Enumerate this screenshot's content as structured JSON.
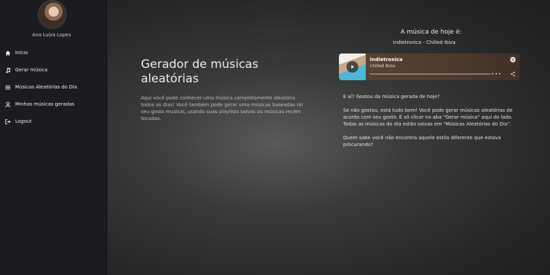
{
  "sidebar": {
    "user_name": "Ana Luiza Lopes",
    "items": [
      {
        "label": "Início",
        "icon": "home-icon"
      },
      {
        "label": "Gerar música",
        "icon": "music-note-icon"
      },
      {
        "label": "Músicas Aleatórias do Dia",
        "icon": "list-icon"
      },
      {
        "label": "Minhas músicas geradas",
        "icon": "user-icon"
      },
      {
        "label": "Logout",
        "icon": "logout-icon"
      }
    ]
  },
  "main": {
    "title": "Gerador de músicas aleatórias",
    "description": "Aqui você pode conhecer uma música completamente aleatória todos os dias! Você também pode gerar uma músicas baseadas no seu gosto musical, usando suas playlists salvas ou músicas recém tocadas."
  },
  "today": {
    "label": "A música de hoje é:",
    "track": "Indietronica - Chilled Ibiza",
    "player": {
      "title": "Indietronica",
      "subtitle": "Chilled Ibiza",
      "more": "•••",
      "progress": 0
    }
  },
  "info": {
    "p1": "E aí? Gostou da música gerada de hoje?",
    "p2": "Se não gostou, está tudo bem! Você pode gerar músicas aleatórias de acordo com seu gosto. É só clicar na aba \"Gerar música\" aqui do lado.",
    "p3": "Todas as músicas do dia estão salvas em \"Músicas Aleatórias do Dia\".",
    "p4": "Quem sabe você não encontra aquele estilo diferente que estava procurando?"
  },
  "colors": {
    "sidebar_bg": "#1a1c1f",
    "player_bg": "#4e3b2e"
  }
}
